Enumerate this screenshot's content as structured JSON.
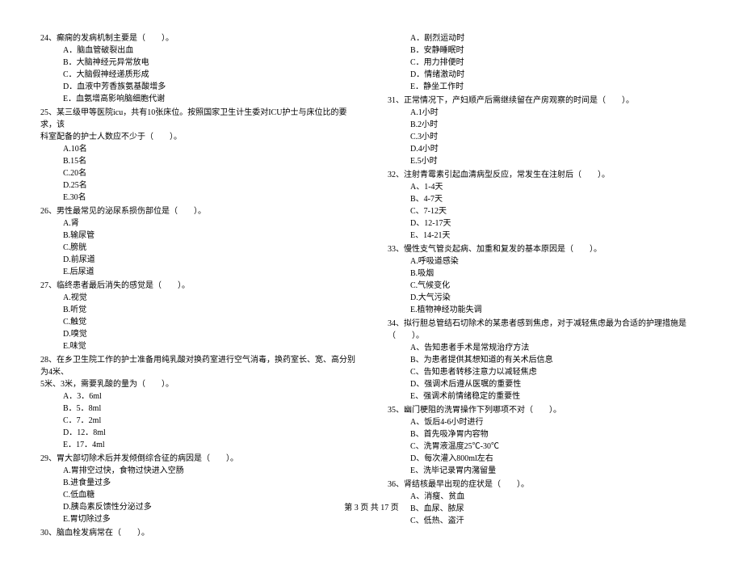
{
  "footer": "第 3 页 共 17 页",
  "left": {
    "q24": {
      "stem": "24、癫痫的发病机制主要是（　　）。",
      "opts": [
        "A．脑血管破裂出血",
        "B．大脑神经元异常放电",
        "C．大脑假神经递质形成",
        "D．血液中芳香族氨基酸增多",
        "E．血氨增高影响脑细胞代谢"
      ]
    },
    "q25": {
      "stem1": "25、某三级甲等医院icu，共有10张床位。按照国家卫生计生委对ICU护士与床位比的要求，该",
      "stem2": "科室配备的护士人数应不少于（　　）。",
      "opts": [
        "A.10名",
        "B.15名",
        "C.20名",
        "D.25名",
        "E.30名"
      ]
    },
    "q26": {
      "stem": "26、男性最常见的泌尿系损伤部位是（　　）。",
      "opts": [
        "A.肾",
        "B.输尿管",
        "C.膀胱",
        "D.前尿道",
        "E.后尿道"
      ]
    },
    "q27": {
      "stem": "27、临终患者最后消失的感觉是（　　）。",
      "opts": [
        "A.视觉",
        "B.听觉",
        "C.触觉",
        "D.嗅觉",
        "E.味觉"
      ]
    },
    "q28": {
      "stem1": "28、在乡卫生院工作的护士准备用纯乳酸对换药室进行空气消毒，换药室长、宽、高分别为4米、",
      "stem2": "5米、3米，需要乳酸的量为（　　）。",
      "opts": [
        "A．3．6ml",
        "B．5．8ml",
        "C．7．2ml",
        "D．12．8ml",
        "E．17．4ml"
      ]
    },
    "q29": {
      "stem": "29、胃大部切除术后并发倾倒综合征的病因是（　　）。",
      "opts": [
        "A.胃排空过快，食物过快进入空肠",
        "B.进食量过多",
        "C.低血糖",
        "D.胰岛素反馈性分泌过多",
        "E.胃切除过多"
      ]
    },
    "q30": {
      "stem": "30、脑血栓发病常在（　　）。"
    }
  },
  "right": {
    "q30opts": [
      "A．剧烈运动时",
      "B．安静睡眠时",
      "C．用力排便时",
      "D．情绪激动时",
      "E．静坐工作时"
    ],
    "q31": {
      "stem": "31、正常情况下，产妇顺产后需继续留在产房观察的时间是（　　）。",
      "opts": [
        "A.1小时",
        "B.2小时",
        "C.3小时",
        "D.4小时",
        "E.5小时"
      ]
    },
    "q32": {
      "stem": "32、注射青霉素引起血清病型反应，常发生在注射后（　　）。",
      "opts": [
        "A、1-4天",
        "B、4-7天",
        "C、7-12天",
        "D、12-17天",
        "E、14-21天"
      ]
    },
    "q33": {
      "stem": "33、慢性支气管炎起病、加重和复发的基本原因是（　　）。",
      "opts": [
        "A.呼吸道感染",
        "B.吸烟",
        "C.气候变化",
        "D.大气污染",
        "E.植物神经功能失调"
      ]
    },
    "q34": {
      "stem": "34、拟行胆总管结石切除术的某患者感到焦虑，对于减轻焦虑最为合适的护理措施是（　　）。",
      "opts": [
        "A、告知患者手术是常规治疗方法",
        "B、为患者提供其想知道的有关术后信息",
        "C、告知患者转移注意力以减轻焦虑",
        "D、强调术后遵从医嘱的重要性",
        "E、强调术前情绪稳定的重要性"
      ]
    },
    "q35": {
      "stem": "35、幽门梗阻的洗胃操作下列哪项不对（　　）。",
      "opts": [
        "A、饭后4-6小时进行",
        "B、首先吸净胃内容物",
        "C、洗胃液温度25℃-30℃",
        "D、每次灌入800ml左右",
        "E、洗毕记录胃内潴留量"
      ]
    },
    "q36": {
      "stem": "36、肾结核最早出现的症状是（　　）。",
      "opts": [
        "A、消瘦、贫血",
        "B、血尿、脓尿",
        "C、低热、盗汗"
      ]
    }
  }
}
